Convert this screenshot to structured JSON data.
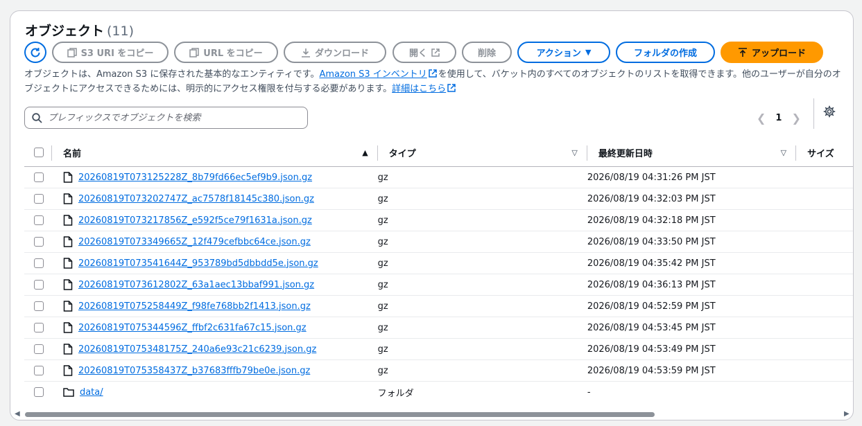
{
  "header": {
    "title": "オブジェクト",
    "count": "(11)"
  },
  "toolbar": {
    "copy_s3_uri": "S3 URI をコピー",
    "copy_url": "URL をコピー",
    "download": "ダウンロード",
    "open": "開く",
    "delete": "削除",
    "actions": "アクション",
    "create_folder": "フォルダの作成",
    "upload": "アップロード"
  },
  "description": {
    "text1": "オブジェクトは、Amazon S3 に保存された基本的なエンティティです。",
    "link1": "Amazon S3 インベントリ",
    "text2": "を使用して、バケット内のすべてのオブジェクトのリストを取得できます。他のユーザーが自分のオブジェクトにアクセスできるためには、明示的にアクセス権限を付与する必要があります。",
    "link2": "詳細はこちら"
  },
  "search": {
    "placeholder": "プレフィックスでオブジェクトを検索"
  },
  "pagination": {
    "current_page": "1"
  },
  "table": {
    "columns": {
      "name": "名前",
      "type": "タイプ",
      "modified": "最終更新日時",
      "size": "サイズ"
    },
    "rows": [
      {
        "name": "20260819T073125228Z_8b79fd66ec5ef9b9.json.gz",
        "type": "gz",
        "modified": "2026/08/19 04:31:26 PM JST"
      },
      {
        "name": "20260819T073202747Z_ac7578f18145c380.json.gz",
        "type": "gz",
        "modified": "2026/08/19 04:32:03 PM JST"
      },
      {
        "name": "20260819T073217856Z_e592f5ce79f1631a.json.gz",
        "type": "gz",
        "modified": "2026/08/19 04:32:18 PM JST"
      },
      {
        "name": "20260819T073349665Z_12f479cefbbc64ce.json.gz",
        "type": "gz",
        "modified": "2026/08/19 04:33:50 PM JST"
      },
      {
        "name": "20260819T073541644Z_953789bd5dbbdd5e.json.gz",
        "type": "gz",
        "modified": "2026/08/19 04:35:42 PM JST"
      },
      {
        "name": "20260819T073612802Z_63a1aec13bbaf991.json.gz",
        "type": "gz",
        "modified": "2026/08/19 04:36:13 PM JST"
      },
      {
        "name": "20260819T075258449Z_f98fe768bb2f1413.json.gz",
        "type": "gz",
        "modified": "2026/08/19 04:52:59 PM JST"
      },
      {
        "name": "20260819T075344596Z_ffbf2c631fa67c15.json.gz",
        "type": "gz",
        "modified": "2026/08/19 04:53:45 PM JST"
      },
      {
        "name": "20260819T075348175Z_240a6e93c21c6239.json.gz",
        "type": "gz",
        "modified": "2026/08/19 04:53:49 PM JST"
      },
      {
        "name": "20260819T075358437Z_b37683fffb79be0e.json.gz",
        "type": "gz",
        "modified": "2026/08/19 04:53:59 PM JST"
      },
      {
        "name": "data/",
        "type": "フォルダ",
        "modified": "-",
        "is_folder": true
      }
    ]
  },
  "colors": {
    "link": "#006ce0",
    "accent_orange": "#ff9900",
    "disabled": "#8d9299"
  }
}
